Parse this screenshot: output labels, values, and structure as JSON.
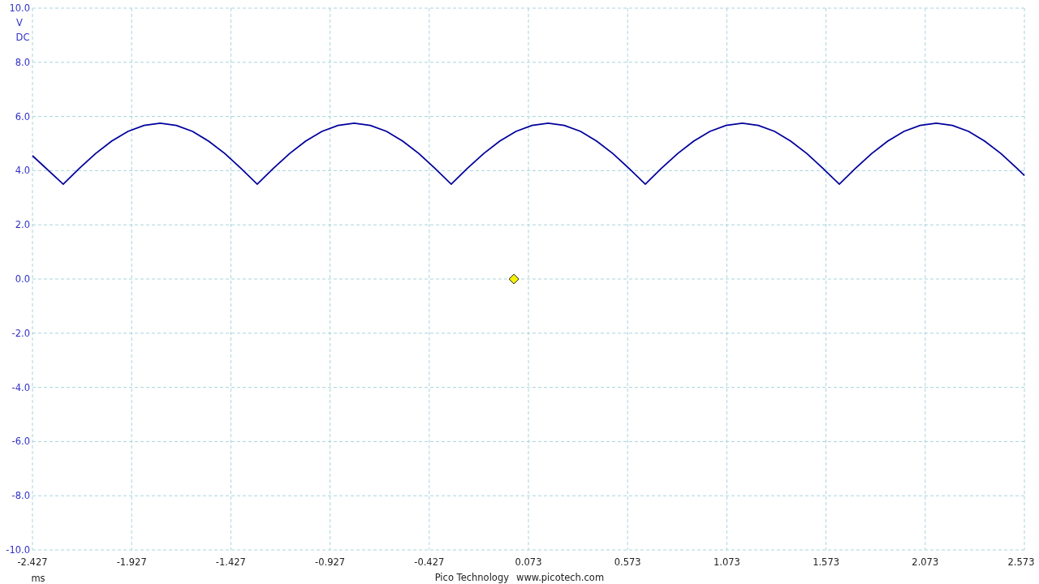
{
  "scope": {
    "coupling": "DC",
    "chart_data": {
      "type": "line",
      "grid": true,
      "xlabel": "ms",
      "ylabel": "V",
      "xlim": [
        -2.427,
        2.573
      ],
      "ylim": [
        -10,
        10
      ],
      "xticks": [
        {
          "value": -2.427,
          "label": "-2.427"
        },
        {
          "value": -1.927,
          "label": "-1.927"
        },
        {
          "value": -1.427,
          "label": "-1.427"
        },
        {
          "value": -0.927,
          "label": "-0.927"
        },
        {
          "value": -0.427,
          "label": "-0.427"
        },
        {
          "value": 0.073,
          "label": "0.073"
        },
        {
          "value": 0.573,
          "label": "0.573"
        },
        {
          "value": 1.073,
          "label": "1.073"
        },
        {
          "value": 1.573,
          "label": "1.573"
        },
        {
          "value": 2.073,
          "label": "2.073"
        },
        {
          "value": 2.573,
          "label": "2.573"
        }
      ],
      "yticks": [
        {
          "value": 10,
          "label": "10.0"
        },
        {
          "value": 8,
          "label": "8.0"
        },
        {
          "value": 6,
          "label": "6.0"
        },
        {
          "value": 4,
          "label": "4.0"
        },
        {
          "value": 2,
          "label": "2.0"
        },
        {
          "value": 0,
          "label": "0.0"
        },
        {
          "value": -2,
          "label": "-2.0"
        },
        {
          "value": -4,
          "label": "-4.0"
        },
        {
          "value": -6,
          "label": "-6.0"
        },
        {
          "value": -8,
          "label": "-8.0"
        },
        {
          "value": -10,
          "label": "-10.0"
        }
      ],
      "x": [
        -2.427,
        -2.272,
        -2.191,
        -2.109,
        -2.028,
        -1.946,
        -1.865,
        -1.783,
        -1.702,
        -1.62,
        -1.539,
        -1.457,
        -1.376,
        -1.294,
        -1.213,
        -1.131,
        -1.05,
        -0.968,
        -0.887,
        -0.805,
        -0.724,
        -0.642,
        -0.561,
        -0.479,
        -0.398,
        -0.316,
        -0.235,
        -0.153,
        -0.072,
        0.01,
        0.091,
        0.173,
        0.254,
        0.336,
        0.417,
        0.499,
        0.58,
        0.662,
        0.743,
        0.825,
        0.906,
        0.988,
        1.069,
        1.151,
        1.232,
        1.314,
        1.395,
        1.477,
        1.558,
        1.64,
        1.721,
        1.803,
        1.884,
        1.966,
        2.047,
        2.129,
        2.21,
        2.292,
        2.373,
        2.455,
        2.536,
        2.573
      ],
      "series": [
        {
          "color": "#00009c",
          "values": [
            4.55,
            3.5,
            4.08,
            4.63,
            5.09,
            5.45,
            5.67,
            5.75,
            5.67,
            5.45,
            5.09,
            4.63,
            4.08,
            3.5,
            4.08,
            4.63,
            5.09,
            5.45,
            5.67,
            5.75,
            5.67,
            5.45,
            5.09,
            4.63,
            4.08,
            3.5,
            4.08,
            4.63,
            5.09,
            5.45,
            5.67,
            5.75,
            5.67,
            5.45,
            5.09,
            4.63,
            4.08,
            3.5,
            4.08,
            4.63,
            5.09,
            5.45,
            5.67,
            5.75,
            5.67,
            5.45,
            5.09,
            4.63,
            4.08,
            3.5,
            4.08,
            4.63,
            5.09,
            5.45,
            5.67,
            5.75,
            5.67,
            5.45,
            5.09,
            4.63,
            4.08,
            3.82
          ]
        }
      ]
    }
  },
  "footer": {
    "company": "Pico Technology",
    "website": "www.picotech.com"
  }
}
